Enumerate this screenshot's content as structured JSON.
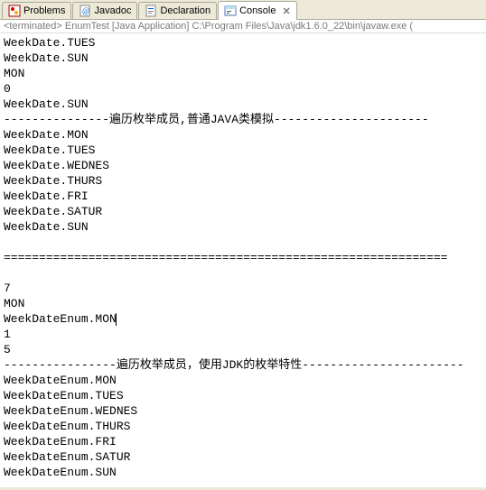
{
  "tabs": [
    {
      "label": "Problems",
      "icon": "problems"
    },
    {
      "label": "Javadoc",
      "icon": "javadoc"
    },
    {
      "label": "Declaration",
      "icon": "declaration"
    },
    {
      "label": "Console",
      "icon": "console",
      "active": true,
      "closable": true
    }
  ],
  "status": "<terminated> EnumTest [Java Application] C:\\Program Files\\Java\\jdk1.6.0_22\\bin\\javaw.exe  (",
  "console": {
    "lines": [
      "WeekDate.TUES",
      "WeekDate.SUN",
      "MON",
      "0",
      "WeekDate.SUN",
      "---------------遍历枚举成员,普通JAVA类模拟----------------------",
      "WeekDate.MON",
      "WeekDate.TUES",
      "WeekDate.WEDNES",
      "WeekDate.THURS",
      "WeekDate.FRI",
      "WeekDate.SATUR",
      "WeekDate.SUN",
      "",
      "===============================================================",
      "",
      "7",
      "MON",
      "WeekDateEnum.MON",
      "1",
      "5",
      "----------------遍历枚举成员，使用JDK的枚举特性-----------------------",
      "WeekDateEnum.MON",
      "WeekDateEnum.TUES",
      "WeekDateEnum.WEDNES",
      "WeekDateEnum.THURS",
      "WeekDateEnum.FRI",
      "WeekDateEnum.SATUR",
      "WeekDateEnum.SUN"
    ],
    "cursor_line": 18
  },
  "close_glyph": "✕"
}
